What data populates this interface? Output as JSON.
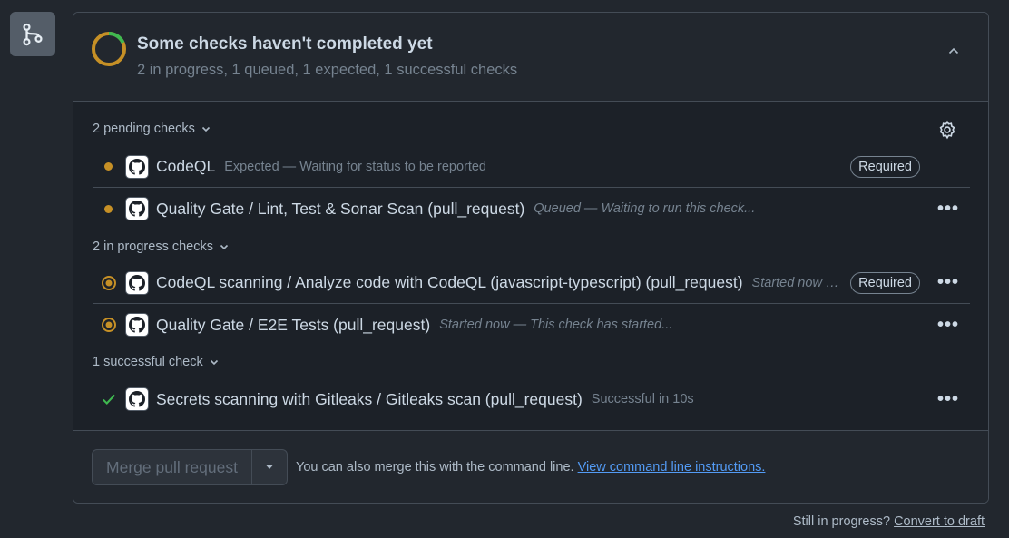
{
  "icon": "git-pull-request-icon",
  "header": {
    "title": "Some checks haven't completed yet",
    "subtitle": "2 in progress, 1 queued, 1 expected, 1 successful checks",
    "ring_colors": {
      "done": "#3fb950",
      "pending": "#c69026"
    }
  },
  "groups": {
    "pending": {
      "label": "2 pending checks"
    },
    "in_progress": {
      "label": "2 in progress checks"
    },
    "successful": {
      "label": "1 successful check"
    }
  },
  "checks": [
    {
      "name": "CodeQL",
      "desc": "Expected — Waiting for status to be reported",
      "badge": "Required",
      "status": "expected"
    },
    {
      "name": "Quality Gate / Lint, Test & Sonar Scan (pull_request)",
      "desc": "Queued — Waiting to run this check...",
      "status": "queued"
    },
    {
      "name": "CodeQL scanning / Analyze code with CodeQL (javascript-typescript) (pull_request)",
      "desc": "Started now — This check has started...",
      "badge": "Required",
      "status": "in_progress"
    },
    {
      "name": "Quality Gate / E2E Tests (pull_request)",
      "desc": "Started now — This check has started...",
      "status": "in_progress"
    },
    {
      "name": "Secrets scanning with Gitleaks / Gitleaks scan (pull_request)",
      "desc": "Successful in 10s",
      "status": "success"
    }
  ],
  "more_label": "•••",
  "footer": {
    "merge_button": "Merge pull request",
    "note": "You can also merge this with the command line.",
    "link": "View command line instructions."
  },
  "bottom": {
    "text": "Still in progress?",
    "link": "Convert to draft"
  }
}
